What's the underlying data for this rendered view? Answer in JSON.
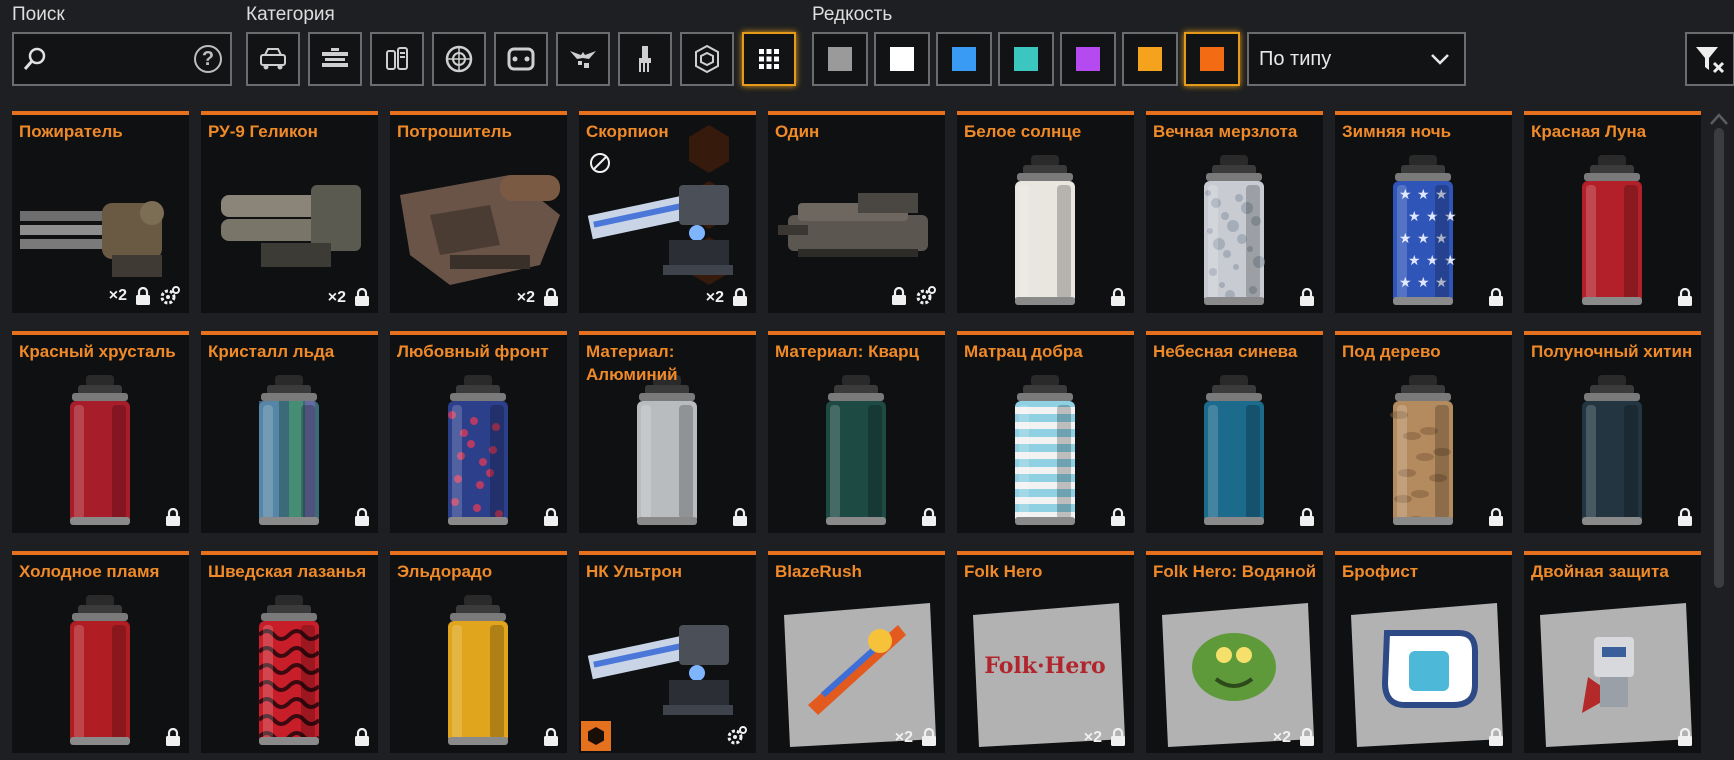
{
  "filters": {
    "search_label": "Поиск",
    "search_value": "",
    "category_label": "Категория",
    "rarity_label": "Редкость",
    "sort_value": "По типу",
    "categories": [
      {
        "icon": "car-body-icon",
        "selected": false
      },
      {
        "icon": "cabin-icon",
        "selected": false
      },
      {
        "icon": "hardware-icon",
        "selected": false
      },
      {
        "icon": "wheel-icon",
        "selected": false
      },
      {
        "icon": "track-icon",
        "selected": false
      },
      {
        "icon": "decor-wings-icon",
        "selected": false
      },
      {
        "icon": "paint-brush-icon",
        "selected": false
      },
      {
        "icon": "hex-badge-icon",
        "selected": false
      },
      {
        "icon": "grid-all-icon",
        "selected": true
      }
    ],
    "rarities": [
      {
        "name": "common",
        "color": "#9a9a9a",
        "selected": false
      },
      {
        "name": "ordinary",
        "color": "#ffffff",
        "selected": false
      },
      {
        "name": "rare",
        "color": "#3a9bf5",
        "selected": false
      },
      {
        "name": "special",
        "color": "#3cc6c0",
        "selected": false
      },
      {
        "name": "epic",
        "color": "#b54af0",
        "selected": false
      },
      {
        "name": "legendary",
        "color": "#f5a21c",
        "selected": false
      },
      {
        "name": "relic",
        "color": "#f36b12",
        "selected": true
      }
    ]
  },
  "items": [
    {
      "name": "Пожиратель",
      "kind": "weapon",
      "variant": "gatling",
      "count": "×2",
      "locked": true,
      "upgrade": true
    },
    {
      "name": "РУ-9 Геликон",
      "kind": "weapon",
      "variant": "launcher",
      "count": "×2",
      "locked": true,
      "upgrade": false
    },
    {
      "name": "Потрошитель",
      "kind": "weapon",
      "variant": "shotgun",
      "count": "×2",
      "locked": true,
      "upgrade": false
    },
    {
      "name": "Скорпион",
      "kind": "weapon",
      "variant": "laser",
      "count": "×2",
      "locked": true,
      "upgrade": false,
      "no_craft": true
    },
    {
      "name": "Один",
      "kind": "weapon",
      "variant": "cannon",
      "count": "",
      "locked": true,
      "upgrade": true
    },
    {
      "name": "Белое солнце",
      "kind": "paint",
      "color": "#e9e6e0",
      "count": "",
      "locked": true
    },
    {
      "name": "Вечная мерзлота",
      "kind": "paint",
      "color": "#c8ccd2",
      "pattern": "frost",
      "count": "",
      "locked": true
    },
    {
      "name": "Зимняя ночь",
      "kind": "paint",
      "color": "#2f55b8",
      "pattern": "stars",
      "count": "",
      "locked": true
    },
    {
      "name": "Красная Луна",
      "kind": "paint",
      "color": "#b3202a",
      "count": "",
      "locked": true
    },
    {
      "name": "Красный хрусталь",
      "kind": "paint",
      "color": "#a81d2a",
      "count": "",
      "locked": true
    },
    {
      "name": "Кристалл льда",
      "kind": "paint",
      "color": "#3b6a78",
      "pattern": "iridescent",
      "count": "",
      "locked": true
    },
    {
      "name": "Любовный фронт",
      "kind": "paint",
      "color": "#2c3f8a",
      "pattern": "love",
      "count": "",
      "locked": true
    },
    {
      "name": "Материал: Алюминий",
      "kind": "paint",
      "color": "#b9bcbf",
      "count": "",
      "locked": true
    },
    {
      "name": "Материал: Кварц",
      "kind": "paint",
      "color": "#1e4a44",
      "count": "",
      "locked": true
    },
    {
      "name": "Матрац добра",
      "kind": "paint",
      "color": "#8fd0e2",
      "pattern": "stripes",
      "count": "",
      "locked": true
    },
    {
      "name": "Небесная синева",
      "kind": "paint",
      "color": "#1c6a8c",
      "count": "",
      "locked": true
    },
    {
      "name": "Под дерево",
      "kind": "paint",
      "color": "#b48b5e",
      "pattern": "wood",
      "count": "",
      "locked": true
    },
    {
      "name": "Полуночный хитин",
      "kind": "paint",
      "color": "#223540",
      "count": "",
      "locked": true
    },
    {
      "name": "Холодное пламя",
      "kind": "paint",
      "color": "#b01e24",
      "count": "",
      "locked": true
    },
    {
      "name": "Шведская лазанья",
      "kind": "paint",
      "color": "#c81e2a",
      "pattern": "waves",
      "count": "",
      "locked": true
    },
    {
      "name": "Эльдорадо",
      "kind": "paint",
      "color": "#e0a51c",
      "count": "",
      "locked": true
    },
    {
      "name": "НК Ультрон",
      "kind": "weapon",
      "variant": "laser",
      "count": "",
      "locked": false,
      "upgrade": true,
      "relic_badge": true
    },
    {
      "name": "BlazeRush",
      "kind": "sticker",
      "art": "blazerush",
      "count": "×2",
      "locked": true
    },
    {
      "name": "Folk Hero",
      "kind": "sticker",
      "art": "folkhero",
      "count": "×2",
      "locked": true
    },
    {
      "name": "Folk Hero: Водяной",
      "kind": "sticker",
      "art": "monster",
      "count": "×2",
      "locked": true
    },
    {
      "name": "Брофист",
      "kind": "sticker",
      "art": "brofist",
      "count": "",
      "locked": true
    },
    {
      "name": "Двойная защита",
      "kind": "sticker",
      "art": "robot",
      "count": "",
      "locked": true
    }
  ]
}
